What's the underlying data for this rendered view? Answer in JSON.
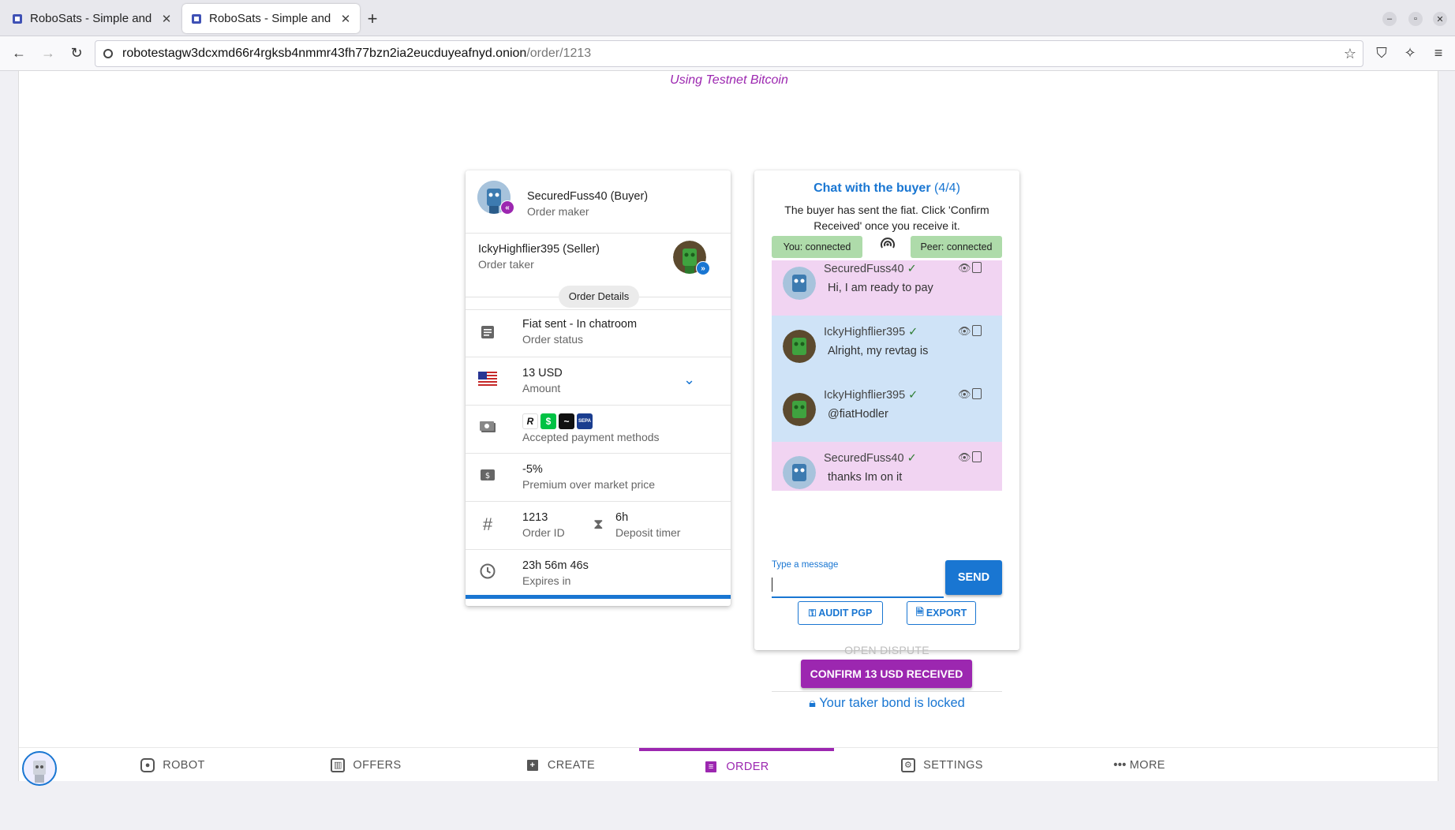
{
  "browser": {
    "tabs": [
      {
        "title": "RoboSats - Simple and Pr"
      },
      {
        "title": "RoboSats - Simple and Pr"
      }
    ],
    "url_host": "robotestagw3dcxmd66r4rgksb4nmmr43fh77bzn2ia2eucduyeafnyd.onion",
    "url_path": "/order/1213"
  },
  "banner": "Using Testnet Bitcoin",
  "order": {
    "maker": {
      "name": "SecuredFuss40 (Buyer)",
      "role": "Order maker"
    },
    "taker": {
      "name": "IckyHighflier395 (Seller)",
      "role": "Order taker"
    },
    "details_label": "Order Details",
    "status": {
      "value": "Fiat sent - In chatroom",
      "label": "Order status"
    },
    "amount": {
      "value": "13 USD",
      "label": "Amount"
    },
    "payment_methods": {
      "label": "Accepted payment methods",
      "icons": [
        "R",
        "$",
        "~",
        "SEPA"
      ]
    },
    "premium": {
      "value": "-5%",
      "label": "Premium over market price"
    },
    "order_id": {
      "value": "1213",
      "label": "Order ID"
    },
    "deposit_timer": {
      "value": "6h",
      "label": "Deposit timer"
    },
    "expires": {
      "value": "23h 56m 46s",
      "label": "Expires in"
    }
  },
  "chat": {
    "title": "Chat with the buyer",
    "count": "(4/4)",
    "subtitle": "The buyer has sent the fiat. Click 'Confirm Received' once you receive it.",
    "you_status": "You: connected",
    "peer_status": "Peer: connected",
    "messages": [
      {
        "author": "SecuredFuss40",
        "text": "Hi, I am ready to pay",
        "side": "buyer"
      },
      {
        "author": "IckyHighflier395",
        "text": "Alright, my revtag is",
        "side": "seller"
      },
      {
        "author": "IckyHighflier395",
        "text": "@fiatHodler",
        "side": "seller"
      },
      {
        "author": "SecuredFuss40",
        "text": "thanks Im on it",
        "side": "buyer"
      }
    ],
    "input_label": "Type a message",
    "send_label": "SEND",
    "audit_label": "AUDIT PGP",
    "export_label": "EXPORT",
    "dispute_label": "OPEN DISPUTE",
    "confirm_label": "CONFIRM 13 USD RECEIVED",
    "bond_text": "Your taker bond is locked"
  },
  "bottom_nav": {
    "robot": "ROBOT",
    "offers": "OFFERS",
    "create": "CREATE",
    "order": "ORDER",
    "settings": "SETTINGS",
    "more": "MORE"
  },
  "colors": {
    "primary": "#1976d2",
    "secondary": "#9c27b0",
    "buyer_bubble": "#f1d4f2",
    "seller_bubble": "#cfe3f7",
    "connected": "#aedbaa"
  }
}
